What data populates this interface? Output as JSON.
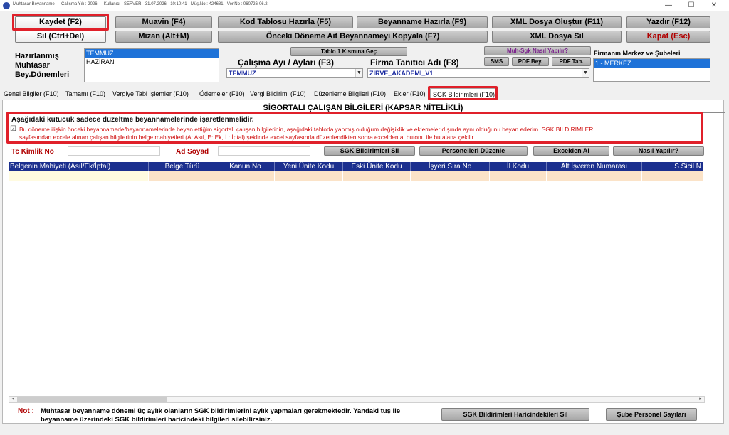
{
  "window": {
    "title": "Muhtasar Beyanname  ---  Çalışma Yılı : 2026  ---  Kullanıcı : SERVER - 31.07.2026 - 10:10:41  -  Müş.No : 424681  -  Ver.No : 060726-06.2",
    "minimize": "—",
    "maximize": "☐",
    "close": "✕"
  },
  "toolbar": {
    "kaydet": "Kaydet (F2)",
    "muavin": "Muavin (F4)",
    "kod_tablosu": "Kod Tablosu Hazırla (F5)",
    "beyanname_hazirla": "Beyanname Hazırla (F9)",
    "xml_olustur": "XML Dosya Oluştur (F11)",
    "yazdir": "Yazdır (F12)",
    "sil": "Sil (Ctrl+Del)",
    "mizan": "Mizan (Alt+M)",
    "onceki_donem": "Önceki Döneme Ait Beyannameyi Kopyala (F7)",
    "xml_sil": "XML Dosya Sil",
    "kapat": "Kapat (Esc)"
  },
  "left": {
    "label_line1": "Hazırlanmış",
    "label_line2": "Muhtasar",
    "label_line3": "Bey.Dönemleri",
    "periods": [
      "TEMMUZ",
      "HAZİRAN"
    ]
  },
  "middle": {
    "tablo1_button": "Tablo 1 Kısmına Geç",
    "calisma_label": "Çalışma Ayı / Ayları (F3)",
    "calisma_value": "TEMMUZ",
    "muh_sgk_button": "Muh-Sgk Nasıl Yapılır?",
    "sms_button": "SMS",
    "pdf_bey_button": "PDF Bey.",
    "pdf_tah_button": "PDF Tah.",
    "firma_label": "Firma Tanıtıcı Adı (F8)",
    "firma_value": "ZİRVE_AKADEMİ_V1"
  },
  "right": {
    "label": "Firmanın Merkez ve Şubeleri",
    "items": [
      "1 - MERKEZ"
    ]
  },
  "tabs": [
    "Genel Bilgiler (F10)",
    "Tamamı (F10)",
    "Vergiye Tabi İşlemler (F10)",
    "Ödemeler (F10)",
    "Vergi Bildirimi (F10)",
    "Düzenleme Bilgileri (F10)",
    "Ekler (F10)",
    "SGK Bildirimleri (F10)"
  ],
  "panel": {
    "title": "SİGORTALI ÇALIŞAN BİLGİLERİ (KAPSAR NİTELİKLİ)",
    "warning_heading": "Aşağıdaki kutucuk sadece düzeltme beyannamelerinde işaretlenmelidir.",
    "warning_text_line1": "Bu döneme ilişkin önceki beyannamede/beyannamelerinde beyan ettiğim sigortalı çalışan bilgilerinin, aşağıdaki tabloda yapmış olduğum değişiklik ve eklemeler dışında aynı olduğunu beyan ederim. SGK BİLDİRİMLERİ",
    "warning_text_line2": "sayfasından excele alınan çalışan bilgilerinin belge mahiyetleri (A: Asıl, E: Ek, İ : İptal) şeklinde excel sayfasında düzenlendikten sonra excelden al butonu ile bu alana çekilir.",
    "checkbox_mark": "☑",
    "tc_label": "Tc Kimlik No",
    "ad_label": "Ad Soyad",
    "sgk_sil_button": "SGK Bildirimleri Sil",
    "personel_button": "Personelleri Düzenle",
    "excelden_button": "Excelden Al",
    "nasil_button": "Nasıl Yapılır?"
  },
  "grid": {
    "columns": [
      "Belgenin Mahiyeti (Asıl/Ek/İptal)",
      "Belge Türü",
      "Kanun No",
      "Yeni Ünite Kodu",
      "Eski Ünite Kodu",
      "İşyeri Sıra No",
      "İl Kodu",
      "Alt İşveren Numarası",
      "S.Sicil N"
    ],
    "scroll_left": "◂",
    "scroll_right": "▸"
  },
  "footer": {
    "not_label": "Not :",
    "note_line1": "Muhtasar beyanname dönemi üç aylık olanların SGK bildirimlerini aylık yapmaları gerekmektedir. Yandaki tuş ile",
    "note_line2": "beyanname üzerindeki SGK bildirimleri haricindeki bilgileri silebilirsiniz.",
    "sgk_haric_button": "SGK Bildirimleri Haricindekileri Sil",
    "sube_button": "Şube Personel Sayıları"
  },
  "colors": {
    "highlight": "#e0202a",
    "grid_header": "#1b2f8e",
    "selection": "#1e72d8",
    "warning_text": "#d01010"
  }
}
